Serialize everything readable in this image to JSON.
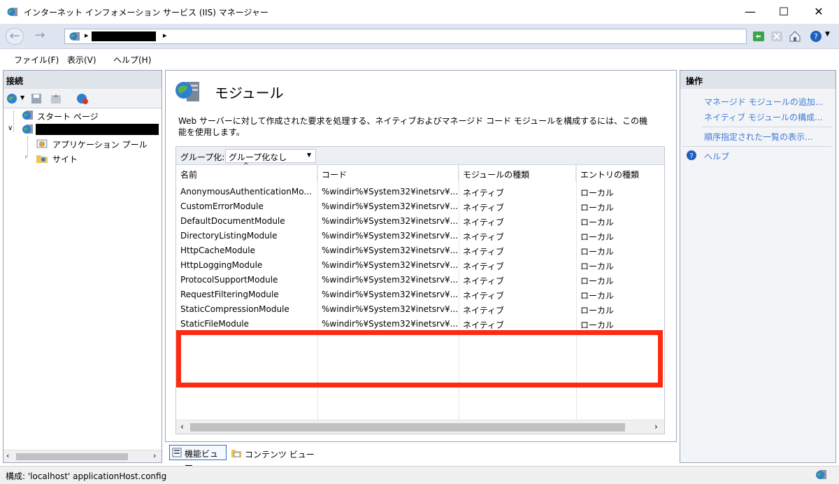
{
  "window": {
    "title": "インターネット インフォメーション サービス (IIS) マネージャー",
    "minimize": "—",
    "maximize": "☐",
    "close": "✕"
  },
  "address": {
    "segments": [
      "▸",
      "▸"
    ]
  },
  "menu": {
    "file": "ファイル(F)",
    "view": "表示(V)",
    "help": "ヘルプ(H)"
  },
  "connections": {
    "header": "接続",
    "tree": {
      "start_page": "スタート ページ",
      "app_pools": "アプリケーション プール",
      "sites": "サイト"
    }
  },
  "main": {
    "title": "モジュール",
    "description": "Web サーバーに対して作成された要求を処理する、ネイティブおよびマネージド コード モジュールを構成するには、この機能を使用します。",
    "group_label": "グループ化:",
    "group_value": "グループ化なし",
    "columns": [
      "名前",
      "コード",
      "モジュールの種類",
      "エントリの種類"
    ],
    "rows": [
      [
        "AnonymousAuthenticationMo...",
        "%windir%¥System32¥inetsrv¥...",
        "ネイティブ",
        "ローカル"
      ],
      [
        "CustomErrorModule",
        "%windir%¥System32¥inetsrv¥...",
        "ネイティブ",
        "ローカル"
      ],
      [
        "DefaultDocumentModule",
        "%windir%¥System32¥inetsrv¥...",
        "ネイティブ",
        "ローカル"
      ],
      [
        "DirectoryListingModule",
        "%windir%¥System32¥inetsrv¥...",
        "ネイティブ",
        "ローカル"
      ],
      [
        "HttpCacheModule",
        "%windir%¥System32¥inetsrv¥...",
        "ネイティブ",
        "ローカル"
      ],
      [
        "HttpLoggingModule",
        "%windir%¥System32¥inetsrv¥...",
        "ネイティブ",
        "ローカル"
      ],
      [
        "ProtocolSupportModule",
        "%windir%¥System32¥inetsrv¥...",
        "ネイティブ",
        "ローカル"
      ],
      [
        "RequestFilteringModule",
        "%windir%¥System32¥inetsrv¥...",
        "ネイティブ",
        "ローカル"
      ],
      [
        "StaticCompressionModule",
        "%windir%¥System32¥inetsrv¥...",
        "ネイティブ",
        "ローカル"
      ],
      [
        "StaticFileModule",
        "%windir%¥System32¥inetsrv¥...",
        "ネイティブ",
        "ローカル"
      ]
    ],
    "highlight_color": "#ff2a12"
  },
  "bottom_tabs": {
    "features": "機能ビュー",
    "content": "コンテンツ ビュー"
  },
  "actions": {
    "header": "操作",
    "add_managed": "マネージド モジュールの追加...",
    "config_native": "ネイティブ モジュールの構成...",
    "ordered_list": "順序指定された一覧の表示...",
    "help": "ヘルプ"
  },
  "status": {
    "text": "構成: 'localhost' applicationHost.config"
  }
}
